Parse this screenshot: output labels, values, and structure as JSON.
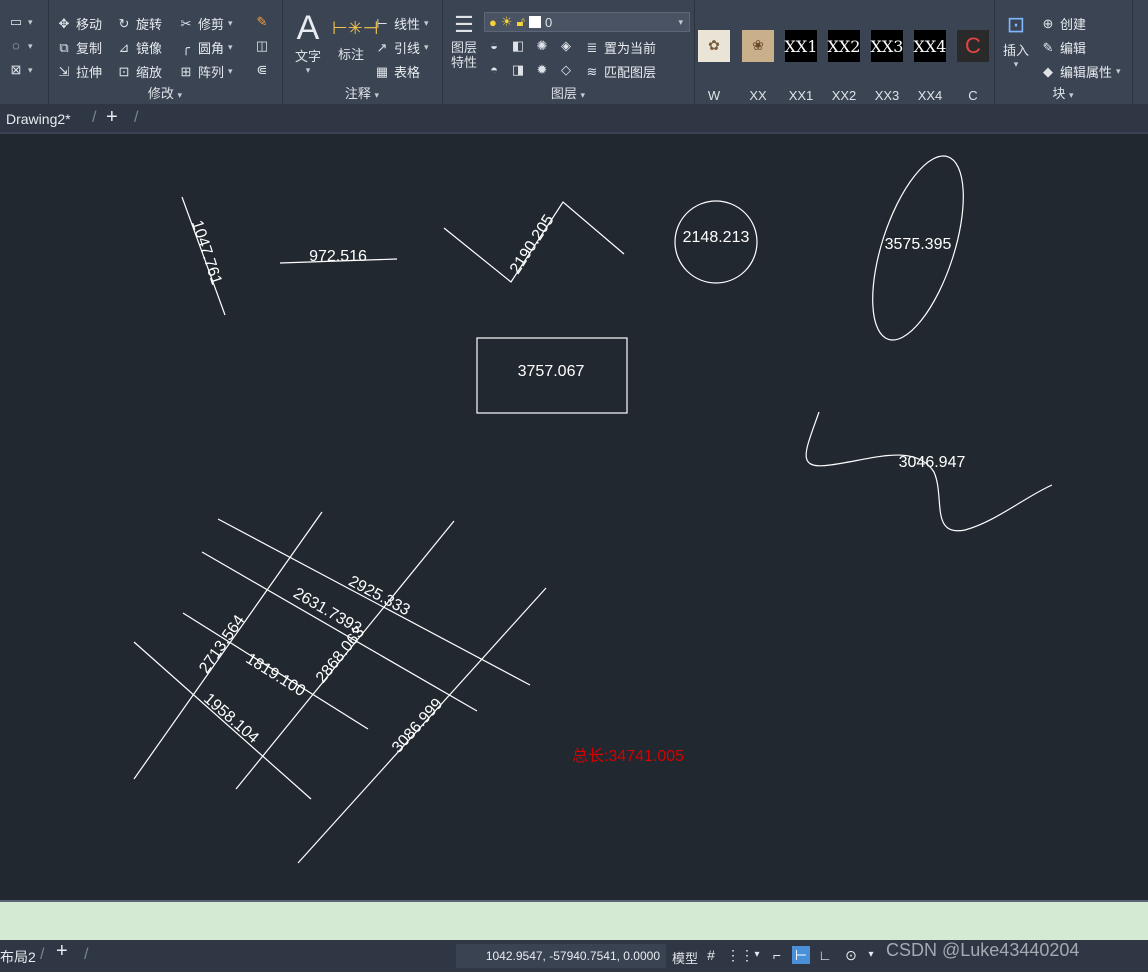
{
  "ribbon": {
    "modify": {
      "title": "修改",
      "move": "移动",
      "rotate": "旋转",
      "trim": "修剪",
      "copy": "复制",
      "mirror": "镜像",
      "fillet": "圆角",
      "stretch": "拉伸",
      "scale": "缩放",
      "array": "阵列"
    },
    "annotation": {
      "title": "注释",
      "text": "文字",
      "dimension": "标注",
      "linear": "线性",
      "leader": "引线",
      "table": "表格"
    },
    "layers": {
      "title": "图层",
      "properties": "图层特性",
      "current_layer": "0",
      "set_current": "置为当前",
      "match_layer": "匹配图层"
    },
    "blocks_gallery": [
      "W",
      "XX",
      "XX1",
      "XX2",
      "XX3",
      "XX4",
      "C"
    ],
    "block": {
      "title": "块",
      "insert": "插入",
      "create": "创建",
      "edit": "编辑",
      "edit_attributes": "编辑属性"
    }
  },
  "tabs": {
    "drawing": "Drawing2*",
    "layout": "布局2"
  },
  "drawing": {
    "labels": {
      "line1": "1047.761",
      "line2": "972.516",
      "polyline": "2190.205",
      "circle": "2148.213",
      "ellipse": "3575.395",
      "rectangle": "3757.067",
      "spline": "3046.947",
      "grid_a": "2925.333",
      "grid_b": "2631.7393",
      "grid_c": "2713.564",
      "grid_d": "1819.100",
      "grid_e": "2868.063",
      "grid_f": "1958.104",
      "grid_g": "3086.999"
    },
    "total": "总长:34741.005",
    "total_color": "#d40000"
  },
  "status": {
    "coordinates": "1042.9547, -57940.7541, 0.0000",
    "model": "模型",
    "watermark": "CSDN @Luke43440204"
  }
}
